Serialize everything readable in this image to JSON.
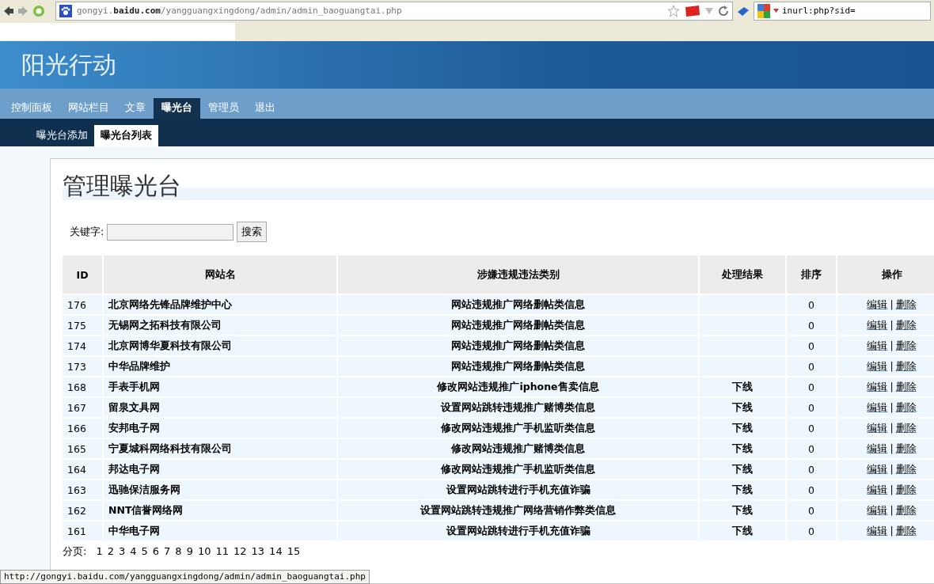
{
  "browser": {
    "url": "gongyi.**baidu.com**/yangguangxingdong/admin/admin_baoguangtai.php",
    "search_value": "inurl:php?sid=",
    "status_url": "http://gongyi.baidu.com/yangguangxingdong/admin/admin_baoguangtai.php"
  },
  "header": {
    "title": "阳光行动"
  },
  "nav": [
    {
      "label": "控制面板",
      "selected": false
    },
    {
      "label": "网站栏目",
      "selected": false
    },
    {
      "label": "文章",
      "selected": false
    },
    {
      "label": "曝光台",
      "selected": true
    },
    {
      "label": "管理员",
      "selected": false
    },
    {
      "label": "退出",
      "selected": false
    }
  ],
  "subnav": [
    {
      "label": "曝光台添加",
      "selected": false
    },
    {
      "label": "曝光台列表",
      "selected": true
    }
  ],
  "page_title": "管理曝光台",
  "search": {
    "label": "关键字:",
    "button": "搜索"
  },
  "table": {
    "columns": [
      "ID",
      "网站名",
      "涉嫌违规违法类别",
      "处理结果",
      "排序",
      "操作"
    ],
    "rows": [
      {
        "id": "176",
        "name": "北京网络先锋品牌维护中心",
        "category": "网站违规推广网络删帖类信息",
        "sort": "0",
        "edit": "编辑",
        "sep": "|",
        "delete": "删除"
      },
      {
        "id": "175",
        "name": "无锡网之拓科技有限公司",
        "category": "网站违规推广网络删帖类信息",
        "sort": "0",
        "edit": "编辑",
        "sep": "|",
        "delete": "删除"
      },
      {
        "id": "174",
        "name": "北京网博华夏科技有限公司",
        "category": "网站违规推广网络删帖类信息",
        "sort": "0",
        "edit": "编辑",
        "sep": "|",
        "delete": "删除"
      },
      {
        "id": "173",
        "name": "中华品牌维护",
        "category": "网站违规推广网络删帖类信息",
        "sort": "0",
        "edit": "编辑",
        "sep": "|",
        "delete": "删除"
      },
      {
        "id": "168",
        "name": "手表手机网",
        "category": "修改网站违规推广iphone售卖信息",
        "result": "下线",
        "sort": "0",
        "edit": "编辑",
        "sep": "|",
        "delete": "删除"
      },
      {
        "id": "167",
        "name": "留泉文具网",
        "category": "设置网站跳转违规推广赌博类信息",
        "result": "下线",
        "sort": "0",
        "edit": "编辑",
        "sep": "|",
        "delete": "删除"
      },
      {
        "id": "166",
        "name": "安邦电子网",
        "category": "修改网站违规推广手机监听类信息",
        "result": "下线",
        "sort": "0",
        "edit": "编辑",
        "sep": "|",
        "delete": "删除"
      },
      {
        "id": "165",
        "name": "宁夏城科网络科技有限公司",
        "category": "修改网站违规推广赌博类信息",
        "result": "下线",
        "sort": "0",
        "edit": "编辑",
        "sep": "|",
        "delete": "删除"
      },
      {
        "id": "164",
        "name": "邦达电子网",
        "category": "修改网站违规推广手机监听类信息",
        "result": "下线",
        "sort": "0",
        "edit": "编辑",
        "sep": "|",
        "delete": "删除"
      },
      {
        "id": "163",
        "name": "迅驰保洁服务网",
        "category": "设置网站跳转进行手机充值诈骗",
        "result": "下线",
        "sort": "0",
        "edit": "编辑",
        "sep": "|",
        "delete": "删除"
      },
      {
        "id": "162",
        "name": "NNT信誉网络网",
        "category": "设置网站跳转违规推广网络营销作弊类信息",
        "result": "下线",
        "sort": "0",
        "edit": "编辑",
        "sep": "|",
        "delete": "删除"
      },
      {
        "id": "161",
        "name": "中华电子网",
        "category": "设置网站跳转进行手机充值诈骗",
        "result": "下线",
        "sort": "0",
        "edit": "编辑",
        "sep": "|",
        "delete": "删除"
      }
    ]
  },
  "pagination": {
    "label": "分页:",
    "pages": [
      "1",
      "2",
      "3",
      "4",
      "5",
      "6",
      "7",
      "8",
      "9",
      "10",
      "11",
      "12",
      "13",
      "14",
      "15"
    ]
  }
}
